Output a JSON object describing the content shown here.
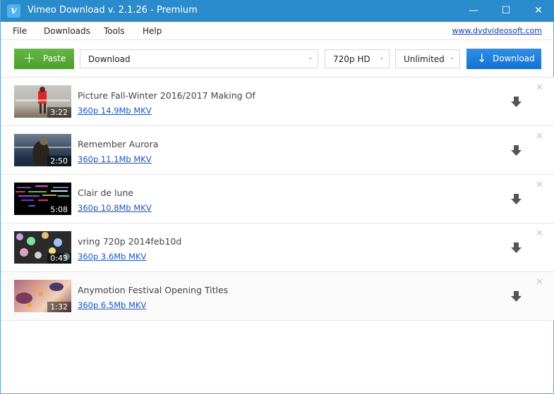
{
  "window": {
    "title": "Vimeo Download v. 2.1.26 - Premium",
    "app_icon_glyph": "v",
    "controls": {
      "minimize": "—",
      "maximize": "☐",
      "close": "✕"
    }
  },
  "menu": {
    "items": [
      "File",
      "Downloads",
      "Tools",
      "Help"
    ],
    "site_link": "www.dvdvideosoft.com"
  },
  "toolbar": {
    "paste_label": "Paste",
    "paste_icon": "+",
    "mode_select": "Download",
    "quality_select": "720p HD",
    "speed_select": "Unlimited",
    "download_label": "Download",
    "download_icon": "↓",
    "chevron": "⌄"
  },
  "colors": {
    "titlebar": "#2a8ccd",
    "paste_button": "#58aa36",
    "download_button": "#1f7fdc",
    "link": "#1a56c4"
  },
  "videos": [
    {
      "title": "Picture Fall-Winter 2016/2017 Making Of",
      "format": "360p 14.9Mb MKV",
      "duration": "3:22"
    },
    {
      "title": "Remember Aurora",
      "format": "360p 11.1Mb MKV",
      "duration": "2:50"
    },
    {
      "title": "Clair de lune",
      "format": "360p 10.8Mb MKV",
      "duration": "5:08"
    },
    {
      "title": "vring 720p 2014feb10d",
      "format": "360p 3.6Mb MKV",
      "duration": "0:43"
    },
    {
      "title": "Anymotion Festival Opening Titles",
      "format": "360p 6.5Mb MKV",
      "duration": "1:32"
    }
  ],
  "remove_glyph": "✕"
}
